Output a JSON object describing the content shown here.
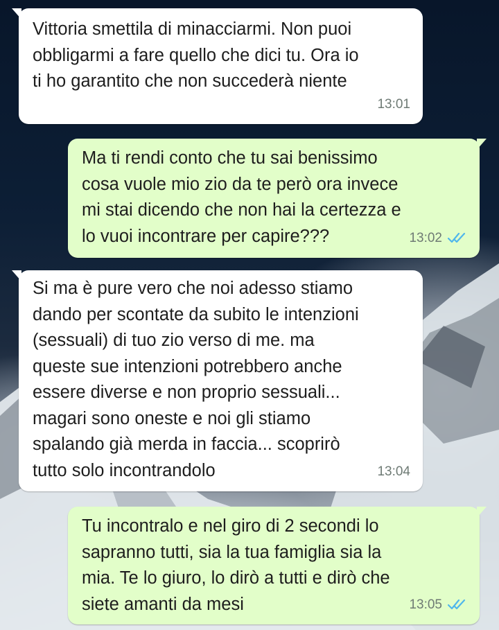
{
  "colors": {
    "incoming_bubble": "#ffffff",
    "outgoing_bubble": "#e2fec9",
    "read_ticks": "#4fb6ec",
    "timestamp": "#6e7a74"
  },
  "messages": [
    {
      "direction": "incoming",
      "text": "Vittoria smettila di minacciarmi. Non puoi\nobbligarmi a fare quello che dici tu. Ora io\nti ho garantito che non succederà niente",
      "time": "13:01"
    },
    {
      "direction": "outgoing",
      "text": "Ma ti rendi conto che tu sai benissimo\ncosa vuole mio zio da te però ora invece\nmi stai dicendo che non hai la certezza e\nlo vuoi incontrare per capire???",
      "time": "13:02",
      "status_icon": "double-check-read-icon"
    },
    {
      "direction": "incoming",
      "text": "Si ma è pure vero che noi adesso stiamo\ndando per scontate da subito le intenzioni\n(sessuali) di tuo zio verso di me. ma\nqueste sue intenzioni potrebbero anche\nessere diverse e non proprio sessuali...\nmagari sono oneste e noi gli stiamo\nspalando già merda in faccia...  scoprirò\ntutto solo incontrandolo",
      "time": "13:04"
    },
    {
      "direction": "outgoing",
      "text": "Tu incontralo e nel giro di 2 secondi lo\nsapranno tutti, sia la tua famiglia sia la\nmia. Te lo giuro, lo dirò a tutti e dirò che\nsiete amanti da mesi",
      "time": "13:05",
      "status_icon": "double-check-read-icon"
    }
  ]
}
